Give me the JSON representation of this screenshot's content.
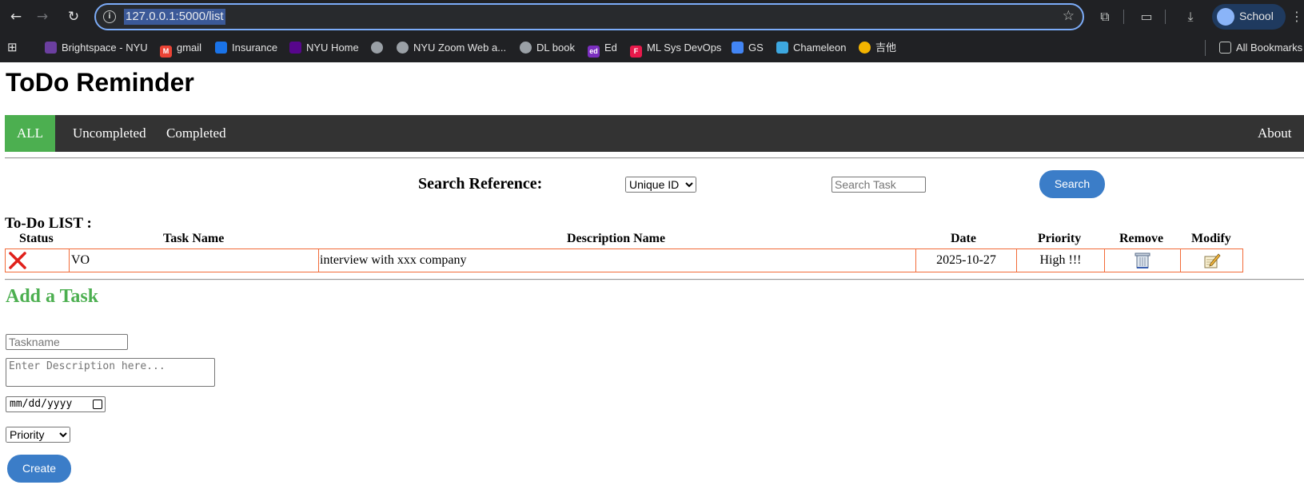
{
  "browser": {
    "url": "127.0.0.1:5000/list",
    "profile_name": "School",
    "bookmarks": [
      {
        "label": "Brightspace - NYU",
        "icon": "brightspace-icon",
        "color": "#6b3fa0"
      },
      {
        "label": "gmail",
        "icon": "gmail-icon",
        "color": "#ea4335"
      },
      {
        "label": "Insurance",
        "icon": "insurance-icon",
        "color": "#1a73e8"
      },
      {
        "label": "NYU Home",
        "icon": "nyu-icon",
        "color": "#57068c"
      },
      {
        "label": "",
        "icon": "globe-icon",
        "color": "#9aa0a6"
      },
      {
        "label": "NYU Zoom Web a...",
        "icon": "globe-icon",
        "color": "#9aa0a6"
      },
      {
        "label": "DL book",
        "icon": "globe-icon",
        "color": "#9aa0a6"
      },
      {
        "label": "Ed",
        "icon": "ed-icon",
        "color": "#7b2fbf"
      },
      {
        "label": "ML Sys DevOps",
        "icon": "f-icon",
        "color": "#e8194b"
      },
      {
        "label": "GS",
        "icon": "bar-chart-icon",
        "color": "#4285f4"
      },
      {
        "label": "Chameleon",
        "icon": "chameleon-icon",
        "color": "#3da8e0"
      },
      {
        "label": "吉他",
        "icon": "guitar-icon",
        "color": "#f4b400"
      }
    ],
    "all_bookmarks": "All Bookmarks"
  },
  "page": {
    "title": "ToDo Reminder",
    "nav": {
      "all": "ALL",
      "uncompleted": "Uncompleted",
      "completed": "Completed",
      "about": "About"
    },
    "search": {
      "label": "Search Reference:",
      "select_value": "Unique ID",
      "placeholder": "Search Task",
      "button": "Search"
    },
    "list": {
      "title": "To-Do LIST :",
      "headers": {
        "status": "Status",
        "task_name": "Task Name",
        "description": "Description Name",
        "date": "Date",
        "priority": "Priority",
        "remove": "Remove",
        "modify": "Modify"
      },
      "rows": [
        {
          "status": "uncompleted",
          "task": "VO",
          "description": "interview with xxx company",
          "date": "2025-10-27",
          "priority": "High !!!"
        }
      ]
    },
    "add": {
      "title": "Add a Task",
      "taskname_placeholder": "Taskname",
      "description_placeholder": "Enter Description here...",
      "date_placeholder": "mm/dd/yyyy",
      "priority_value": "Priority",
      "create": "Create"
    }
  }
}
